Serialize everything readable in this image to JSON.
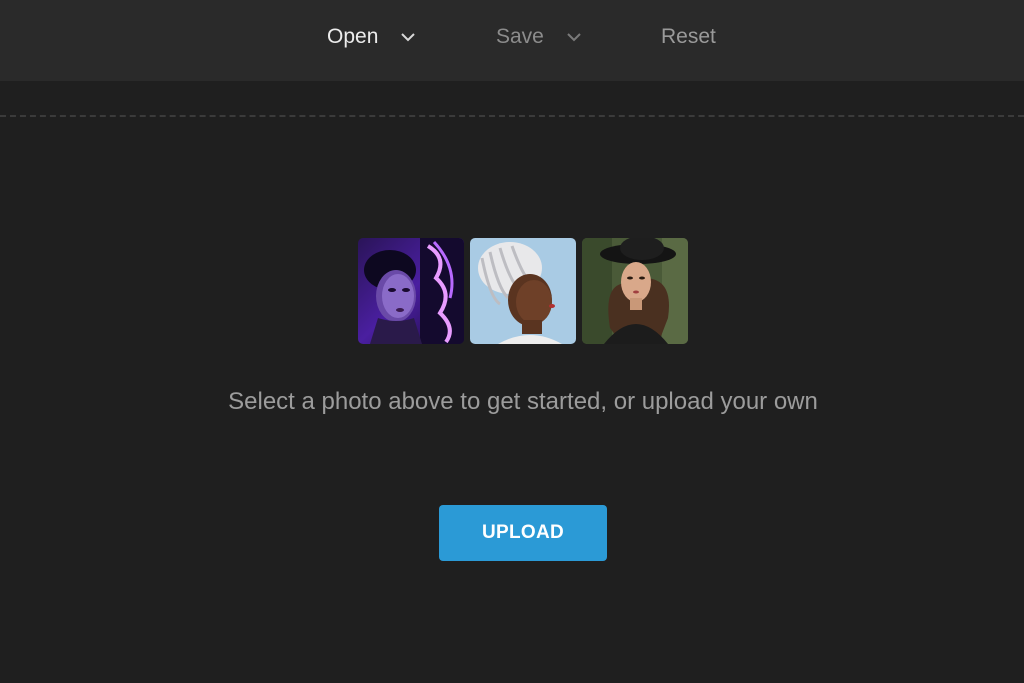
{
  "toolbar": {
    "open_label": "Open",
    "save_label": "Save",
    "reset_label": "Reset"
  },
  "thumbnails": [
    {
      "description_icon": "photo-woman-neon-sign"
    },
    {
      "description_icon": "photo-woman-white-braids"
    },
    {
      "description_icon": "photo-woman-black-hat"
    }
  ],
  "main": {
    "prompt": "Select a photo above to get started, or upload your own",
    "upload_label": "UPLOAD"
  },
  "colors": {
    "background": "#1f1f1f",
    "topbar": "#2a2a2a",
    "accent": "#2b9ad6"
  }
}
